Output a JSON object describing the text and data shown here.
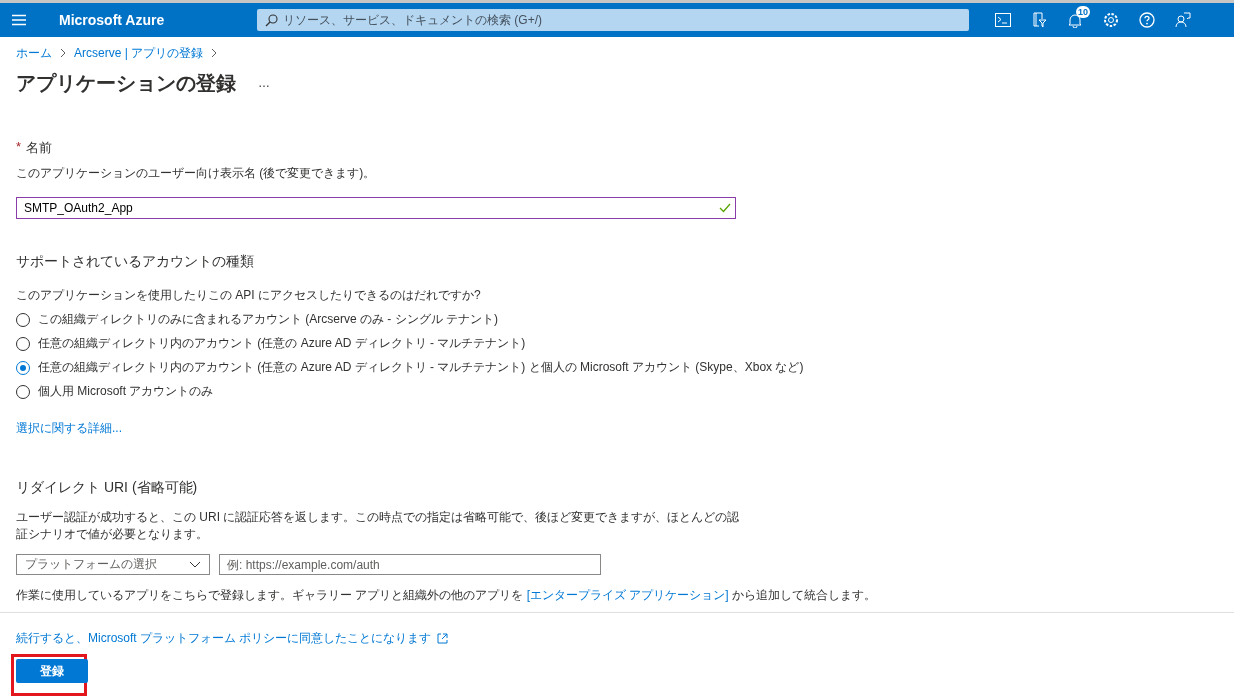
{
  "top_bar": {
    "brand": "Microsoft Azure",
    "search": {
      "placeholder": "リソース、サービス、ドキュメントの検索 (G+/)"
    },
    "notification_count": "10"
  },
  "breadcrumb": [
    "ホーム",
    "Arcserve | アプリの登録"
  ],
  "page_title": "アプリケーションの登録",
  "more": "…",
  "name_section": {
    "required_mark": "*",
    "label": "名前",
    "help": "このアプリケーションのユーザー向け表示名 (後で変更できます)。",
    "value": "SMTP_OAuth2_App",
    "valid": true
  },
  "account_types": {
    "heading": "サポートされているアカウントの種類",
    "question": "このアプリケーションを使用したりこの API にアクセスしたりできるのはだれですか?",
    "options": [
      {
        "label": "この組織ディレクトリのみに含まれるアカウント (Arcserve のみ - シングル テナント)",
        "selected": false
      },
      {
        "label": "任意の組織ディレクトリ内のアカウント (任意の Azure AD ディレクトリ - マルチテナント)",
        "selected": false
      },
      {
        "label": "任意の組織ディレクトリ内のアカウント (任意の Azure AD ディレクトリ - マルチテナント) と個人の Microsoft アカウント (Skype、Xbox など)",
        "selected": true
      },
      {
        "label": "個人用 Microsoft アカウントのみ",
        "selected": false
      }
    ],
    "details_link": "選択に関する詳細..."
  },
  "redirect_uri": {
    "heading": "リダイレクト URI (省略可能)",
    "description": "ユーザー認証が成功すると、この URI に認証応答を返します。この時点での指定は省略可能で、後ほど変更できますが、ほとんどの認証シナリオで値が必要となります。",
    "platform": {
      "placeholder": "プラットフォームの選択"
    },
    "uri": {
      "placeholder": "例: https://example.com/auth"
    }
  },
  "note": {
    "before": "作業に使用しているアプリをこちらで登録します。ギャラリー アプリと組織外の他のアプリを ",
    "link": "[エンタープライズ アプリケーション]",
    "after": " から追加して統合します。"
  },
  "footer": {
    "policy_link": "続行すると、Microsoft プラットフォーム ポリシーに同意したことになります",
    "register_button": {
      "label": "登録",
      "highlighted": true
    }
  }
}
